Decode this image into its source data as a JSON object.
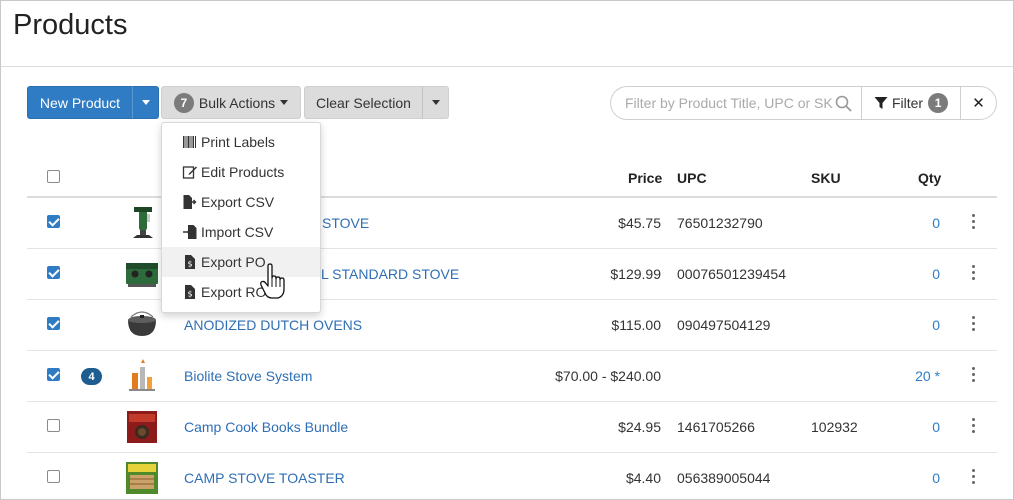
{
  "page": {
    "title": "Products"
  },
  "toolbar": {
    "new_product_label": "New Product",
    "bulk_count": "7",
    "bulk_actions_label": "Bulk Actions",
    "clear_selection_label": "Clear Selection"
  },
  "search": {
    "placeholder": "Filter by Product Title, UPC or SKU",
    "value": ""
  },
  "filter": {
    "label": "Filter",
    "count": "1"
  },
  "close_label": "✕",
  "table": {
    "headers": {
      "price": "Price",
      "upc": "UPC",
      "sku": "SKU",
      "qty": "Qty"
    },
    "rows": [
      {
        "checked": true,
        "badge": "",
        "title": "STOVE",
        "price": "$45.75",
        "upc": "76501232790",
        "sku": "",
        "qty": "0"
      },
      {
        "checked": true,
        "badge": "",
        "title": "L STANDARD STOVE",
        "price": "$129.99",
        "upc": "00076501239454",
        "sku": "",
        "qty": "0"
      },
      {
        "checked": true,
        "badge": "",
        "title": "ANODIZED DUTCH OVENS",
        "price": "$115.00",
        "upc": "090497504129",
        "sku": "",
        "qty": "0"
      },
      {
        "checked": true,
        "badge": "4",
        "title": "Biolite Stove System",
        "price": "$70.00 - $240.00",
        "upc": "",
        "sku": "",
        "qty": "20 *"
      },
      {
        "checked": false,
        "badge": "",
        "title": "Camp Cook Books Bundle",
        "price": "$24.95",
        "upc": "1461705266",
        "sku": "102932",
        "qty": "0"
      },
      {
        "checked": false,
        "badge": "",
        "title": "CAMP STOVE TOASTER",
        "price": "$4.40",
        "upc": "056389005044",
        "sku": "",
        "qty": "0"
      }
    ]
  },
  "bulk_menu": {
    "items": [
      {
        "label": "Print Labels",
        "icon": "barcode-icon"
      },
      {
        "label": "Edit Products",
        "icon": "edit-icon"
      },
      {
        "label": "Export CSV",
        "icon": "export-file-icon"
      },
      {
        "label": "Import CSV",
        "icon": "import-file-icon"
      },
      {
        "label": "Export PO",
        "icon": "invoice-file-icon"
      },
      {
        "label": "Export RO",
        "icon": "invoice-file-icon"
      }
    ],
    "hovered": "Export PO"
  },
  "colors": {
    "primary": "#2f7cc4",
    "link": "#2f6fb5",
    "badge_dark": "#1f5c8f"
  }
}
